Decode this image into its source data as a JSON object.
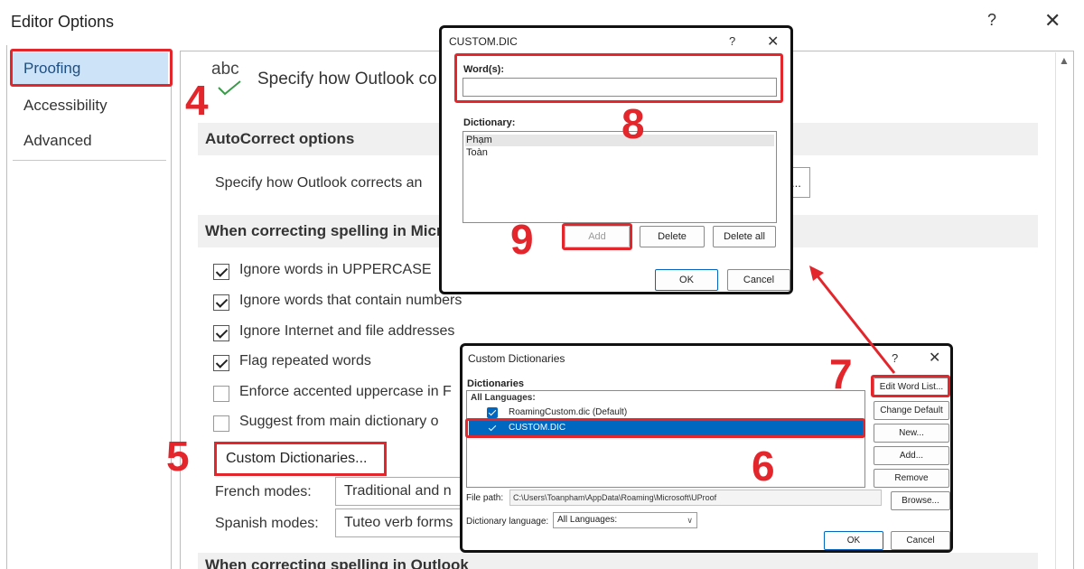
{
  "window": {
    "title": "Editor Options",
    "help_glyph": "?",
    "close_glyph": "✕"
  },
  "nav": {
    "items": [
      {
        "label": "Proofing",
        "active": true
      },
      {
        "label": "Accessibility",
        "active": false
      },
      {
        "label": "Advanced",
        "active": false
      }
    ]
  },
  "proofing": {
    "icon_text": "abc",
    "description": "Specify how Outlook co                                              mails.",
    "autocorrect": {
      "heading": "AutoCorrect options",
      "description": "Specify how Outlook corrects an",
      "button_edge": "..."
    },
    "spelling_office_heading": "When correcting spelling in Micr",
    "options": [
      {
        "label": "Ignore words in UPPERCASE",
        "checked": true
      },
      {
        "label": "Ignore words that contain numbers",
        "checked": true
      },
      {
        "label": "Ignore Internet and file addresses",
        "checked": true
      },
      {
        "label": "Flag repeated words",
        "checked": true
      },
      {
        "label": "Enforce accented uppercase in F",
        "checked": false
      },
      {
        "label": "Suggest from main dictionary o",
        "checked": false
      }
    ],
    "custom_dictionaries_button": "Custom Dictionaries...",
    "french_modes": {
      "label": "French modes:",
      "value": "Traditional and n"
    },
    "spanish_modes": {
      "label": "Spanish modes:",
      "value": "Tuteo verb forms"
    },
    "spelling_outlook_heading": "When correcting spelling in Outlook"
  },
  "custom_dic_dialog": {
    "title": "CUSTOM.DIC",
    "help_glyph": "?",
    "close_glyph": "✕",
    "words_label": "Word(s):",
    "words_value": "",
    "dictionary_label": "Dictionary:",
    "entries": [
      "Phạm",
      "Toàn"
    ],
    "add_label": "Add",
    "delete_label": "Delete",
    "delete_all_label": "Delete all",
    "ok_label": "OK",
    "cancel_label": "Cancel"
  },
  "custom_dictionaries_dialog": {
    "title": "Custom Dictionaries",
    "help_glyph": "?",
    "close_glyph": "✕",
    "dictionaries_label": "Dictionaries",
    "group_label": "All Languages:",
    "items": [
      {
        "label": "RoamingCustom.dic (Default)",
        "checked": true,
        "selected": false
      },
      {
        "label": "CUSTOM.DIC",
        "checked": true,
        "selected": true
      }
    ],
    "buttons": {
      "edit_word_list": "Edit Word List...",
      "change_default": "Change Default",
      "new": "New...",
      "add": "Add...",
      "remove": "Remove",
      "browse": "Browse..."
    },
    "file_path_label": "File path:",
    "file_path_value": "C:\\Users\\Toanpham\\AppData\\Roaming\\Microsoft\\UProof",
    "language_label": "Dictionary language:",
    "language_value": "All Languages:",
    "ok_label": "OK",
    "cancel_label": "Cancel"
  },
  "annotations": {
    "step_4": "4",
    "step_5": "5",
    "step_6": "6",
    "step_7": "7",
    "step_8": "8",
    "step_9": "9",
    "color": "#e3262c"
  }
}
